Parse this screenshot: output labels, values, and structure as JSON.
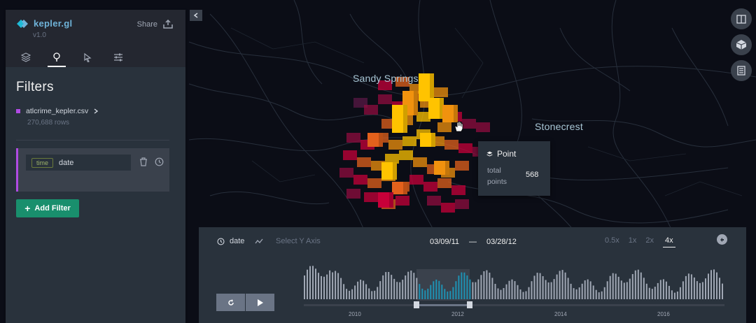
{
  "app": {
    "name": "kepler.gl",
    "version": "v1.0",
    "share_label": "Share"
  },
  "icons": {
    "logo": "kepler-diamond-icon",
    "share": "export-icon",
    "tabs": [
      "layers-icon",
      "filter-icon",
      "interaction-icon",
      "settings-icon"
    ],
    "collapse": "chevron-left-icon",
    "map_controls": [
      "split-map-icon",
      "3d-view-icon",
      "legend-icon"
    ],
    "play": "play-icon",
    "reset": "reset-icon"
  },
  "sidebar": {
    "title": "Filters",
    "dataset": {
      "name": "atlcrime_kepler.csv",
      "rows": "270,688 rows",
      "color": "#b04be3"
    },
    "filter": {
      "type_badge": "time",
      "field": "date"
    },
    "add_filter_label": "Add Filter"
  },
  "map": {
    "labels": [
      "Sandy Springs",
      "Stonecrest"
    ]
  },
  "tooltip": {
    "title": "Point",
    "label": "total points",
    "value": "568"
  },
  "time_panel": {
    "field": "date",
    "y_axis_placeholder": "Select Y Axis",
    "range_start": "03/09/11",
    "range_sep": "—",
    "range_end": "03/28/12",
    "speeds": [
      "0.5x",
      "1x",
      "2x",
      "4x"
    ],
    "active_speed": "4x",
    "years": [
      "2010",
      "2012",
      "2014",
      "2016"
    ],
    "accent_color": "#1e92b4"
  },
  "colors": {
    "accent_button": "#198f6d",
    "panel": "#29323c",
    "hex_palette": [
      "#5a1846",
      "#900c3f",
      "#c70039",
      "#e3611c",
      "#f1920e",
      "#ffc300"
    ]
  }
}
